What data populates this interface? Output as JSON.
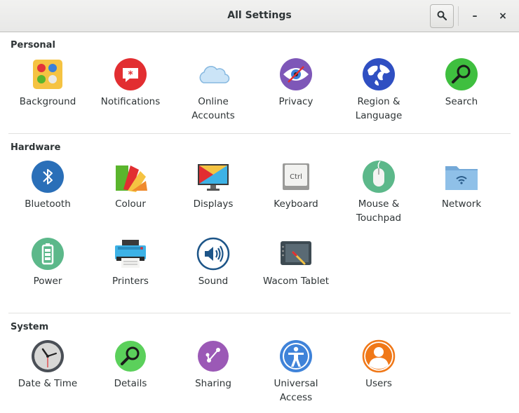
{
  "window": {
    "title": "All Settings"
  },
  "header": {
    "search_icon": "search-icon",
    "minimize_glyph": "–",
    "close_glyph": "×"
  },
  "sections": {
    "personal": {
      "title": "Personal",
      "items": [
        {
          "label": "Background",
          "icon": "background-icon"
        },
        {
          "label": "Notifications",
          "icon": "notifications-icon"
        },
        {
          "label": "Online\nAccounts",
          "icon": "online-accounts-icon"
        },
        {
          "label": "Privacy",
          "icon": "privacy-icon"
        },
        {
          "label": "Region &\nLanguage",
          "icon": "region-language-icon"
        },
        {
          "label": "Search",
          "icon": "search-icon"
        }
      ]
    },
    "hardware": {
      "title": "Hardware",
      "items": [
        {
          "label": "Bluetooth",
          "icon": "bluetooth-icon"
        },
        {
          "label": "Colour",
          "icon": "colour-icon"
        },
        {
          "label": "Displays",
          "icon": "displays-icon"
        },
        {
          "label": "Keyboard",
          "icon": "keyboard-icon"
        },
        {
          "label": "Mouse &\nTouchpad",
          "icon": "mouse-icon"
        },
        {
          "label": "Network",
          "icon": "network-icon"
        },
        {
          "label": "Power",
          "icon": "power-icon"
        },
        {
          "label": "Printers",
          "icon": "printer-icon"
        },
        {
          "label": "Sound",
          "icon": "sound-icon"
        },
        {
          "label": "Wacom Tablet",
          "icon": "wacom-tablet-icon"
        }
      ]
    },
    "system": {
      "title": "System",
      "items": [
        {
          "label": "Date & Time",
          "icon": "clock-icon"
        },
        {
          "label": "Details",
          "icon": "details-icon"
        },
        {
          "label": "Sharing",
          "icon": "sharing-icon"
        },
        {
          "label": "Universal\nAccess",
          "icon": "universal-access-icon"
        },
        {
          "label": "Users",
          "icon": "user-icon"
        }
      ]
    }
  },
  "icon_text": {
    "keyboard_key": "Ctrl"
  }
}
